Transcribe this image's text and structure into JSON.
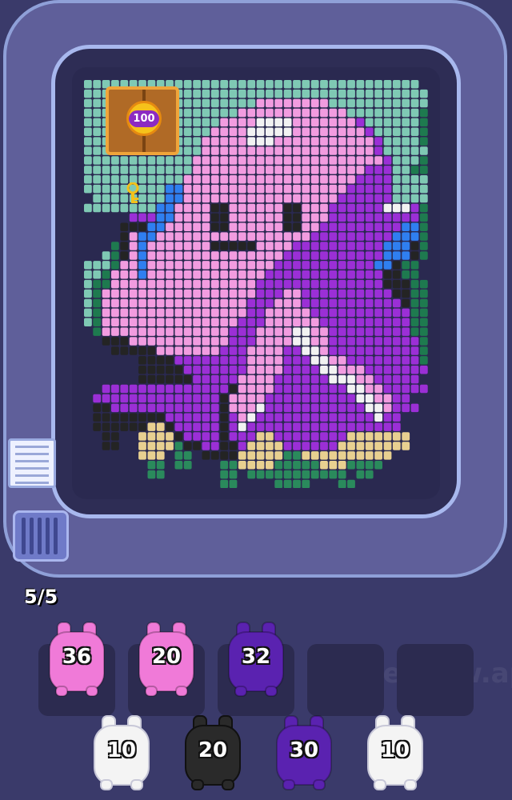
{
  "watermark": "PixelFlow.app",
  "board": {
    "lock_value": "100",
    "colors": {
      "T": "#7fc9b4",
      "t": "#1e7a4f",
      "P": "#f29ce0",
      "p": "#d46ad0",
      "V": "#9b2fd6",
      "v": "#5a1fa0",
      "B": "#2f7ff0",
      "K": "#242424",
      "W": "#f2f2f2",
      "Y": "#e8d090",
      "G": "#2a8a5c",
      "R": "#c8a0b8"
    },
    "grid": [
      "TTTTTTTTTTTTTTTTTTTTTTTTTTTTTTTTTTTTT.",
      "TTTTTTTTTTTTTTTTTTTTTTTTTTTTTTTTTTTTTT",
      "TTTTTTTTTTTTTTTTTTTPPPPPPPPTTTTTTTTTTT",
      "TTTTTTTTTTTTTTTTTPPPPPPPPPPPPTTTTTTTTt",
      "TTTTTTTTTTTTTTTPPPPWWWWPPPPPPPVTTTTTTt",
      "TTTTTTTTTTTTTTPPPPWWWWWPPPPPPPPVTTTTTt",
      "TTTTTTTTTTTTTPPPPPWWWPPPPPPPPPPPVTTTTt",
      "TTTTTTTTTTTTTPPPPPPPPPPPPPPPPPPPVTTTTT",
      "TTTTTTTTTTTTPPPPPPPPPPPPPPPPPPPPPVTTTt",
      "TTTTTTTTTTTTPPPPPPPPPPPPPPPPPPPVVVTTtt",
      "TTTTTTTTTTTPPPPPPPPPPPPPPPPPPPVVVVTTTT",
      "TTTTTTTTTBBPPPPPPPPPPPPPPPPPPVVVVVTTTT",
      ".TTTTTTTTBBPPPPPPPPPPPPPPPPPVVVVVVTTTT",
      "TTTTTTTTBBPPPPKKPPPPPPKKPPPVVVVVVWWWVt",
      ".....VVVBBPPPPKKPPPPPPKKPPPVVVVVVVVVVt",
      "....KKKBBPPPPPKKPPPPPPKKPPVVVVVVVVVBBt",
      "....KPBBPPPPPPPPPPPPPPPPPVVVVVVVVVBBBt",
      "...tKPBPPPPPPPKKKKKPPPPVVVVVVVVVVBBBKt",
      "..TtKPBPPPPPPPPPPPPPPPVVVVVVVVVVVBBBKt",
      "TTTtPPBPPPPPPPPPPPPPPVVVVVVVVVVVBBKtt.",
      "TTtPPPBPPPPPPPPPPPPPVVVVVVVVVVVVVKKtt.",
      "TttPPPPPPPPPPPPPPPPVVVVVVVVVVVVVVKKKtt",
      "TtPPPPPPPPPPPPPPPPPVVVPPVVVVVVVVVVKKtt",
      "TtPPPPPPPPPPPPPPPPVVVPPPVVVVVVVVVVVKtt",
      "TtPPPPPPPPPPPPPPPPVVPPPPPVVVVVVVVVVVtt",
      "TtPPPPPPPPPPPPPPPVVVPPPPPPVVVVVVVVVVtt",
      ".tPPPPPPPPPPPPPPVVVPPPPWWPPVVVVVVVVVtt",
      "..KKKPPPPPPPPPPPVVVPPPPWWPPVVVVVVVVVVt",
      "...KKKKKPPPPPPPVVVPPPPVVWWPVVVVVVVVVVt",
      "......KKKKVVVVVVVVPPPPVVVWWPPVVVVVVVVt",
      "......KKKKKVVVVVVVPPPPVVVVWWPPPVVVVVVV",
      "......KKKKKKVVVVVPPPPVVVVVVWWWPPVVVVV.",
      "..VVVVVVVVVVVVVVKPPPPVVVVVVVVWWPPVVVVV",
      ".VVVVVVVVVVVVVVKPPPPVVVVVVVVVVWWPPVV..",
      ".KKVVVVVVVVVVVVKPPPWVVVVVVVVVVVWWPVVV.",
      ".KKKKKKKKVVVVVVKVPWVVVVVVVVVVVVVWVV...",
      ".KKKKKKYYKVVVVVKVWVVVVVVVVVVVVVVVVV...",
      "..KK..YYYYKVVVVKVVVYYVVVVVVVVYYYYYYY..",
      "..KK..YYYYGKKVVKKVYYYYVVVVVVYYYYYYYY..",
      "......YYY.GG.KKKKYYYYYGGYYYYYYYYYY....",
      ".......GG.GG...GGYYYYGGGGGYYYGGGG.....",
      ".......GG......GG.GGGGGGGGGGG.GG......",
      "...............GG....GGGG...GG........"
    ]
  },
  "pigs_remaining": "5/5",
  "queue_slots": [
    {
      "label": "36",
      "color": "#f07ad8"
    },
    {
      "label": "20",
      "color": "#f07ad8"
    },
    {
      "label": "32",
      "color": "#5a22b0"
    },
    {
      "label": "",
      "color": ""
    },
    {
      "label": "",
      "color": ""
    }
  ],
  "conveyor": [
    {
      "label": "10",
      "color": "#f4f4f4"
    },
    {
      "label": "20",
      "color": "#2a2a2a"
    },
    {
      "label": "30",
      "color": "#5a22b0"
    },
    {
      "label": "10",
      "color": "#f4f4f4"
    }
  ]
}
